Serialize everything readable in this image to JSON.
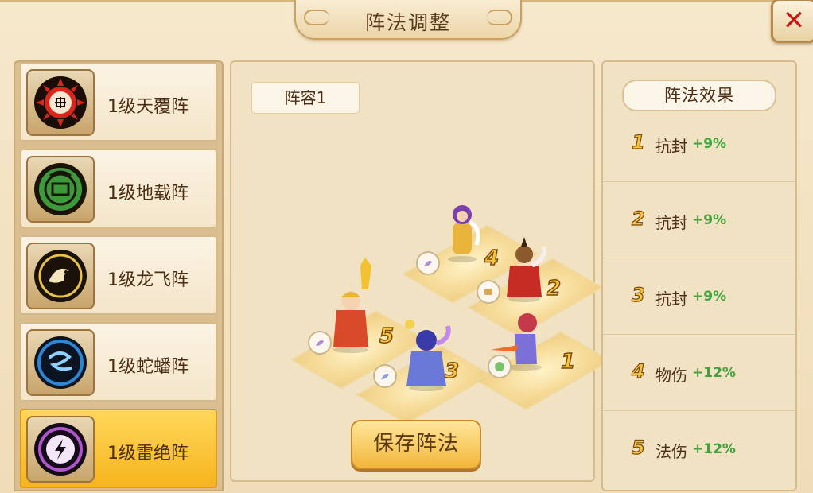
{
  "window": {
    "title": "阵法调整",
    "close_icon": "close-icon"
  },
  "formations": [
    {
      "label": "1级天覆阵",
      "icon": "tianfu-emblem-icon",
      "color": "#d7261c",
      "selected": false
    },
    {
      "label": "1级地载阵",
      "icon": "dizai-emblem-icon",
      "color": "#3d9a3a",
      "selected": false
    },
    {
      "label": "1级龙飞阵",
      "icon": "longfei-emblem-icon",
      "color": "#e8c24a",
      "selected": false
    },
    {
      "label": "1级蛇蟠阵",
      "icon": "shepan-emblem-icon",
      "color": "#2e86d6",
      "selected": false
    },
    {
      "label": "1级雷绝阵",
      "icon": "leijue-emblem-icon",
      "color": "#b057c9",
      "selected": true
    }
  ],
  "lineup": {
    "tab_label": "阵容1",
    "save_label": "保存阵法",
    "positions": [
      "1",
      "2",
      "3",
      "4",
      "5"
    ]
  },
  "effects": {
    "header": "阵法效果",
    "items": [
      {
        "num": "1",
        "name": "抗封",
        "value": "+9%"
      },
      {
        "num": "2",
        "name": "抗封",
        "value": "+9%"
      },
      {
        "num": "3",
        "name": "抗封",
        "value": "+9%"
      },
      {
        "num": "4",
        "name": "物伤",
        "value": "+12%"
      },
      {
        "num": "5",
        "name": "法伤",
        "value": "+12%"
      }
    ]
  },
  "colors": {
    "accent_gold": "#f2b63a",
    "bonus_green": "#3ea13a",
    "close_red": "#c41a16"
  }
}
